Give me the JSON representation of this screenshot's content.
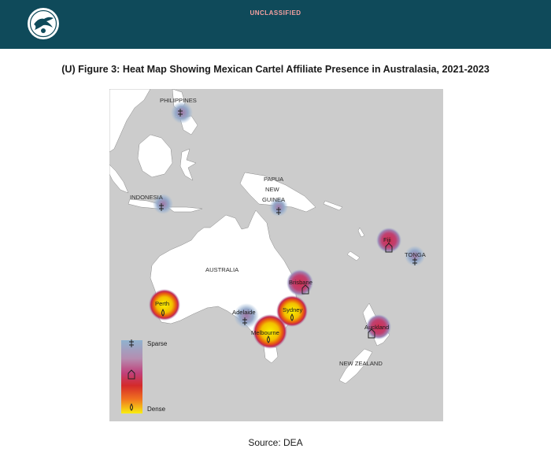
{
  "header": {
    "classification": "UNCLASSIFIED",
    "seal_icon": "agency-seal-icon",
    "background_color": "#0f4a5a"
  },
  "figure_title": "(U) Figure 3: Heat Map Showing Mexican Cartel Affiliate Presence in Australasia, 2021-2023",
  "source": "Source: DEA",
  "map": {
    "land_color": "#ffffff",
    "sea_color": "#cccccc",
    "region_labels": {
      "philippines": "PHILIPPINES",
      "indonesia": "INDONESIA",
      "png_1": "PAPUA",
      "png_2": "NEW",
      "png_3": "GUINEA",
      "australia": "AUSTRALIA",
      "tonga": "TONGA",
      "new_zealand": "NEW ZEALAND"
    },
    "cities": {
      "perth": "Perth",
      "adelaide": "Adelaide",
      "melbourne": "Melbourne",
      "sydney": "Sydney",
      "brisbane": "Brisbane",
      "auckland": "Auckland",
      "fiji": "Fiji"
    },
    "legend": {
      "sparse": "Sparse",
      "dense": "Dense",
      "icons": [
        "sparse-marker-icon",
        "medium-marker-icon",
        "dense-marker-icon"
      ],
      "gradient_colors": [
        "#8fb3cf",
        "#b58db0",
        "#c0407a",
        "#d42a2a",
        "#f07020",
        "#f8ee10"
      ]
    }
  }
}
